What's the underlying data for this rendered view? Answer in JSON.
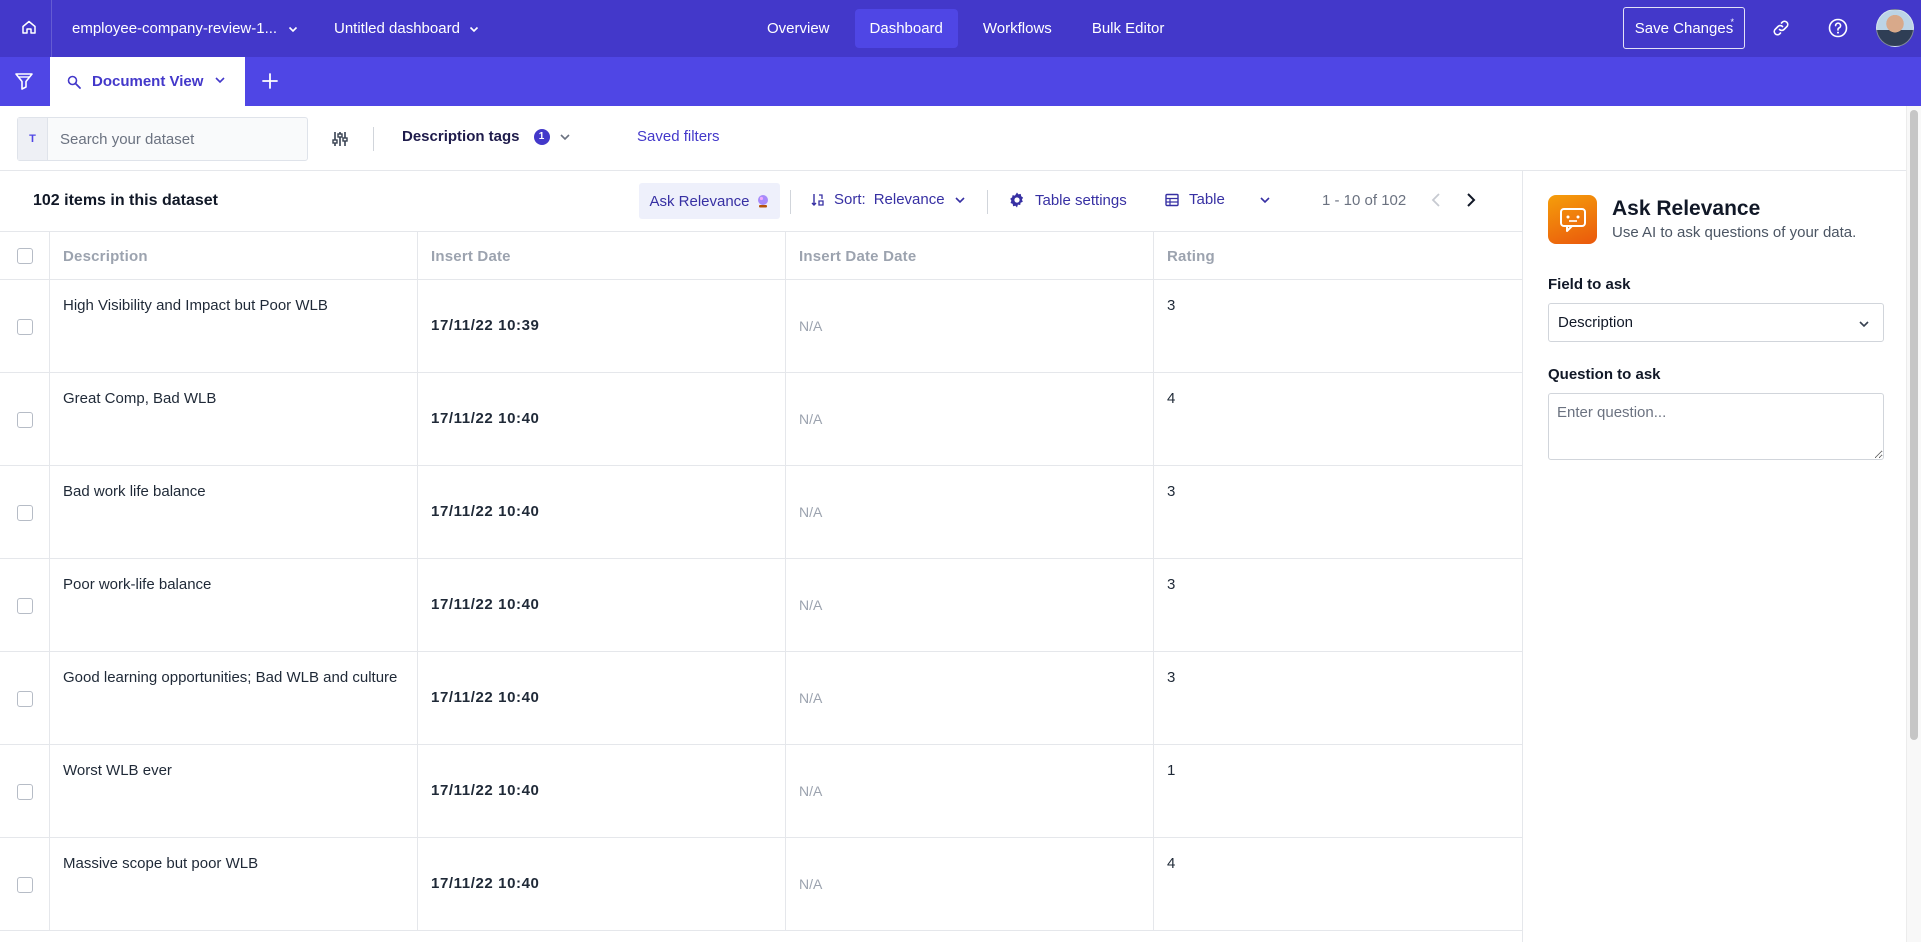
{
  "topnav": {
    "dataset_name": "employee-company-review-1...",
    "dashboard_name": "Untitled dashboard",
    "tabs": [
      {
        "label": "Overview"
      },
      {
        "label": "Dashboard"
      },
      {
        "label": "Workflows"
      },
      {
        "label": "Bulk Editor"
      }
    ],
    "active_tab": "Dashboard",
    "save_label": "Save Changes",
    "save_indicator": "*"
  },
  "subnav": {
    "view_tab_label": "Document View"
  },
  "filters": {
    "search_prefix": "T",
    "search_placeholder": "Search your dataset",
    "tags_label": "Description tags",
    "tags_count": "1",
    "saved_filters_label": "Saved filters"
  },
  "toolbar": {
    "item_count": "102 items in this dataset",
    "ask_label": "Ask Relevance",
    "sort_prefix": "Sort:",
    "sort_value": "Relevance",
    "table_settings_label": "Table settings",
    "view_mode_label": "Table",
    "pagination": "1 - 10 of 102"
  },
  "table": {
    "columns": [
      "Description",
      "Insert Date",
      "Insert Date Date",
      "Rating"
    ],
    "rows": [
      {
        "description": "High Visibility and Impact but Poor WLB",
        "insert_date": "17/11/22 10:39",
        "insert_date_date": "N/A",
        "rating": "3"
      },
      {
        "description": "Great Comp, Bad WLB",
        "insert_date": "17/11/22 10:40",
        "insert_date_date": "N/A",
        "rating": "4"
      },
      {
        "description": "Bad work life balance",
        "insert_date": "17/11/22 10:40",
        "insert_date_date": "N/A",
        "rating": "3"
      },
      {
        "description": "Poor work-life balance",
        "insert_date": "17/11/22 10:40",
        "insert_date_date": "N/A",
        "rating": "3"
      },
      {
        "description": "Good learning opportunities; Bad WLB and culture",
        "insert_date": "17/11/22 10:40",
        "insert_date_date": "N/A",
        "rating": "3"
      },
      {
        "description": "Worst WLB ever",
        "insert_date": "17/11/22 10:40",
        "insert_date_date": "N/A",
        "rating": "1"
      },
      {
        "description": "Massive scope but poor WLB",
        "insert_date": "17/11/22 10:40",
        "insert_date_date": "N/A",
        "rating": "4"
      }
    ]
  },
  "panel": {
    "title": "Ask Relevance",
    "subtitle": "Use AI to ask questions of your data.",
    "field_label": "Field to ask",
    "field_value": "Description",
    "question_label": "Question to ask",
    "question_placeholder": "Enter question...",
    "question_value": ""
  },
  "colors": {
    "nav_primary": "#4338ca",
    "nav_secondary": "#4f46e5",
    "active_tab_bg": "#4f46e5",
    "accent_text": "#3730a3",
    "panel_logo": "#f59e0b"
  },
  "icons": {
    "home": "home-icon",
    "filter": "funnel-icon",
    "doc_view": "search-doc-icon",
    "add_tab": "plus-icon",
    "link": "link-icon",
    "help": "help-icon",
    "adjust": "sliders-icon",
    "sort": "sort-icon",
    "settings": "gear-icon",
    "table": "table-icon",
    "chat": "chat-icon"
  }
}
